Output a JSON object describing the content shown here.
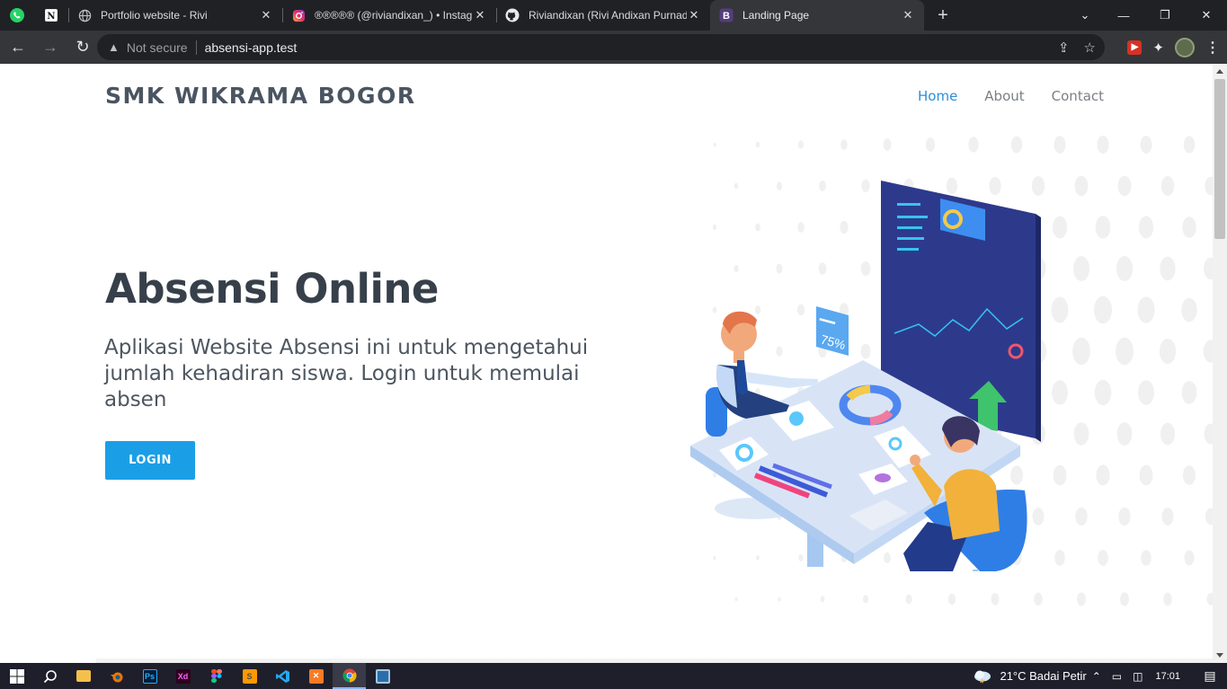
{
  "browser": {
    "tabs": [
      {
        "title": "Portfolio website - Rivi",
        "icon": "globe-icon"
      },
      {
        "title": "®®®®® (@riviandixan_) • Instagram",
        "icon": "instagram-icon"
      },
      {
        "title": "Riviandixan (Rivi Andixan Purnadi)",
        "icon": "github-icon"
      },
      {
        "title": "Landing Page",
        "icon": "bootstrap-icon",
        "active": true
      }
    ],
    "pinned_tabs": [
      "whatsapp-icon",
      "notion-icon"
    ],
    "security_label": "Not secure",
    "url": "absensi-app.test"
  },
  "site": {
    "brand": "SMK WIKRAMA BOGOR",
    "nav": [
      "Home",
      "About",
      "Contact"
    ],
    "active_nav": "Home",
    "hero": {
      "title": "Absensi Online",
      "subtitle": "Aplikasi Website Absensi ini untuk mengetahui jumlah kehadiran siswa. Login untuk memulai absen",
      "button": "LOGIN"
    },
    "illustration": {
      "percent_label": "75%"
    }
  },
  "colors": {
    "primary": "#1a9fe6",
    "nav_active": "#2c8ed9",
    "heading": "#37404a"
  },
  "taskbar": {
    "apps": [
      "windows-start-icon",
      "search-icon",
      "file-explorer-icon",
      "blender-icon",
      "photoshop-icon",
      "adobe-xd-icon",
      "figma-icon",
      "sublime-text-icon",
      "vscode-icon",
      "xampp-icon",
      "chrome-icon",
      "desktop-app-icon"
    ],
    "weather": "21°C  Badai Petir",
    "time": "17:01"
  }
}
